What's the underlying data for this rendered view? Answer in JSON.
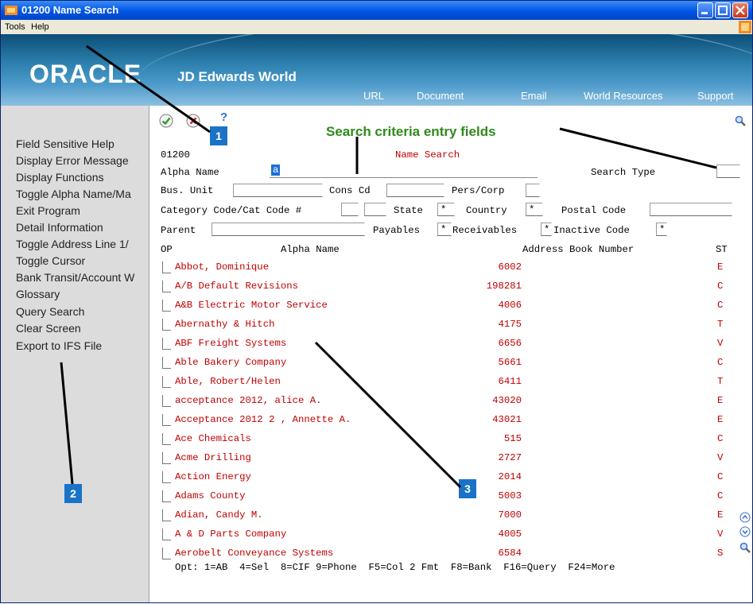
{
  "window": {
    "title": "01200  Name Search",
    "controls": [
      "minimize",
      "maximize",
      "close"
    ]
  },
  "menu": [
    {
      "label": "Tools",
      "underline": "T"
    },
    {
      "label": "Help",
      "underline": "H"
    }
  ],
  "banner": {
    "logo_oracle": "ORACLE",
    "logo_product": "JD Edwards World",
    "links": [
      "URL",
      "Document",
      "Email",
      "World Resources",
      "Support"
    ]
  },
  "sidebar": {
    "items": [
      "Field Sensitive Help",
      "Display Error Message",
      "Display Functions",
      "Toggle Alpha Name/Ma",
      "Exit Program",
      "Detail Information",
      "Toggle Address Line 1/",
      "Toggle Cursor",
      "Bank Transit/Account W",
      "Glossary",
      "Query Search",
      "Clear Screen",
      "Export to IFS File"
    ]
  },
  "toolbar": {
    "ok_icon": "check-icon",
    "cancel_icon": "x-icon",
    "help_label": "?"
  },
  "form": {
    "program_id": "01200",
    "screen_title": "Name Search",
    "alpha_name_label": "Alpha Name",
    "alpha_name_value": "a",
    "search_type_label": "Search Type",
    "bus_unit_label": "Bus. Unit",
    "cons_cd_label": "Cons Cd",
    "pers_corp_label": "Pers/Corp",
    "category_label": "Category Code/Cat Code #",
    "state_label": "State",
    "state_value": "*",
    "country_label": "Country",
    "country_value": "*",
    "postal_label": "Postal Code",
    "parent_label": "Parent",
    "payables_label": "Payables",
    "payables_value": "*",
    "receivables_label": "Receivables",
    "receivables_value": "*",
    "inactive_label": "Inactive Code",
    "inactive_value": "*"
  },
  "grid": {
    "headers": {
      "op": "OP",
      "name": "Alpha Name",
      "number": "Address Book Number",
      "st": "ST"
    },
    "rows": [
      {
        "name": "Abbot, Dominique",
        "number": "6002",
        "st": "E"
      },
      {
        "name": "A/B Default Revisions",
        "number": "198281",
        "st": "C"
      },
      {
        "name": "A&B Electric Motor Service",
        "number": "4006",
        "st": "C"
      },
      {
        "name": "Abernathy & Hitch",
        "number": "4175",
        "st": "T"
      },
      {
        "name": "ABF Freight Systems",
        "number": "6656",
        "st": "V"
      },
      {
        "name": "Able Bakery Company",
        "number": "5661",
        "st": "C"
      },
      {
        "name": "Able, Robert/Helen",
        "number": "6411",
        "st": "T"
      },
      {
        "name": "acceptance 2012, alice A.",
        "number": "43020",
        "st": "E"
      },
      {
        "name": "Acceptance 2012 2 , Annette A.",
        "number": "43021",
        "st": "E"
      },
      {
        "name": "Ace Chemicals",
        "number": "515",
        "st": "C"
      },
      {
        "name": "Acme Drilling",
        "number": "2727",
        "st": "V"
      },
      {
        "name": "Action Energy",
        "number": "2014",
        "st": "C"
      },
      {
        "name": "Adams County",
        "number": "5003",
        "st": "C"
      },
      {
        "name": "Adian, Candy M.",
        "number": "7000",
        "st": "E"
      },
      {
        "name": "A & D Parts Company",
        "number": "4005",
        "st": "V"
      },
      {
        "name": "Aerobelt Conveyance Systems",
        "number": "6584",
        "st": "S"
      }
    ]
  },
  "footer": {
    "function_keys": "Opt: 1=AB  4=Sel  8=CIF 9=Phone  F5=Col 2 Fmt  F8=Bank  F16=Query  F24=More"
  },
  "annotations": {
    "title": "Search criteria entry fields",
    "callouts": [
      "1",
      "2",
      "3"
    ]
  }
}
